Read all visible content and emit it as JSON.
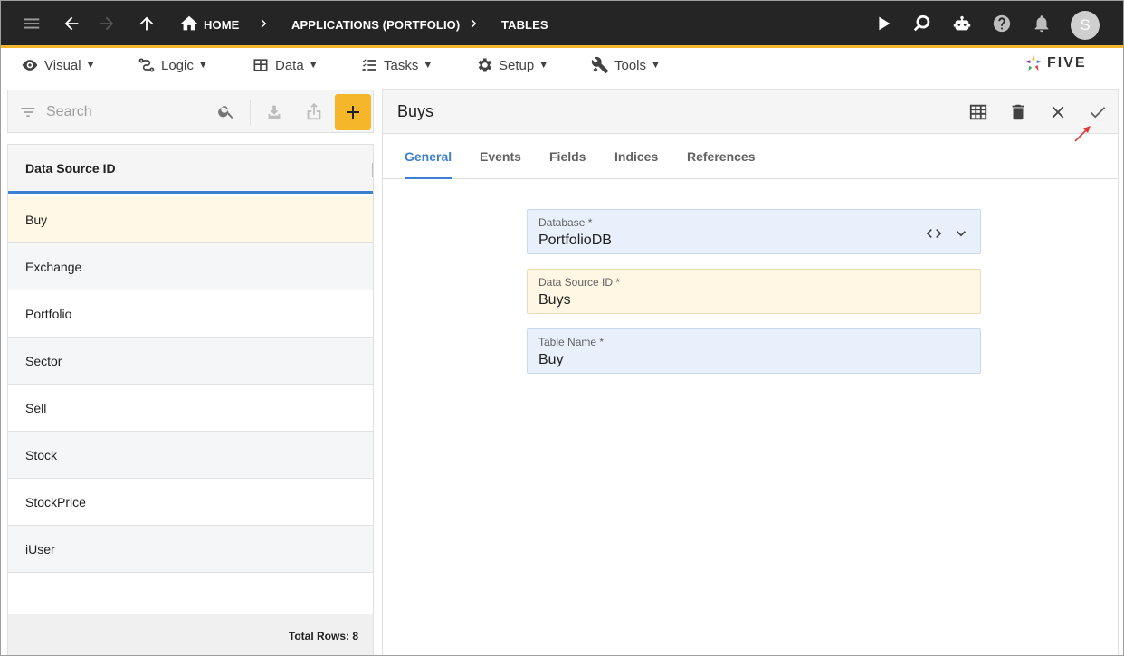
{
  "topbar": {
    "breadcrumbs": [
      "HOME",
      "APPLICATIONS (PORTFOLIO)",
      "TABLES"
    ],
    "avatar_initial": "S"
  },
  "menu": {
    "items": [
      {
        "label": "Visual",
        "icon": "eye-icon"
      },
      {
        "label": "Logic",
        "icon": "logic-icon"
      },
      {
        "label": "Data",
        "icon": "table-icon"
      },
      {
        "label": "Tasks",
        "icon": "tasks-icon"
      },
      {
        "label": "Setup",
        "icon": "gear-icon"
      },
      {
        "label": "Tools",
        "icon": "tools-icon"
      }
    ],
    "caret": "▼",
    "logo_text": "FIVE"
  },
  "list": {
    "search_placeholder": "Search",
    "column_header": "Data Source ID",
    "rows": [
      "Buy",
      "Exchange",
      "Portfolio",
      "Sector",
      "Sell",
      "Stock",
      "StockPrice",
      "iUser"
    ],
    "selected_index": 0,
    "footer": "Total Rows: 8"
  },
  "form": {
    "title": "Buys",
    "tabs": [
      "General",
      "Events",
      "Fields",
      "Indices",
      "References"
    ],
    "active_tab": 0,
    "fields": [
      {
        "label": "Database *",
        "value": "PortfolioDB"
      },
      {
        "label": "Data Source ID *",
        "value": "Buys"
      },
      {
        "label": "Table Name *",
        "value": "Buy"
      }
    ]
  },
  "colors": {
    "accent": "#f5b62a",
    "tab_active": "#3f7fd1",
    "topbar": "#252525",
    "annotation_arrow": "#e53935"
  }
}
